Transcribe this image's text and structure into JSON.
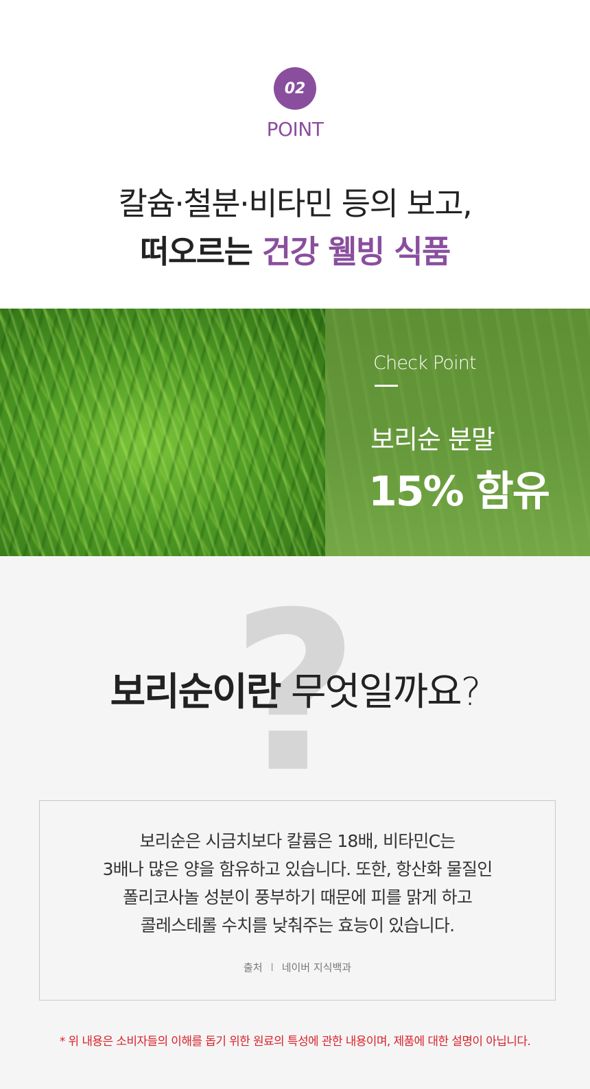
{
  "point": {
    "number": "02",
    "label": "POINT"
  },
  "headline": {
    "line1": "칼슘·철분·비타민 등의 보고,",
    "line2_plain": "떠오르는 ",
    "line2_accent": "건강 웰빙 식품"
  },
  "check_point": {
    "title": "Check Point",
    "subtitle": "보리순 분말",
    "highlight": "15% 함유"
  },
  "question": {
    "mark": "?",
    "bold": "보리순이란",
    "normal": " 무엇일까요?"
  },
  "info_box": {
    "lines": [
      "보리순은 시금치보다 칼륨은 18배, 비타민C는",
      "3배나 많은 양을 함유하고 있습니다. 또한, 항산화 물질인",
      "폴리코사놀 성분이 풍부하기 때문에 피를 맑게 하고",
      "콜레스테롤 수치를 낮춰주는 효능이 있습니다."
    ],
    "source_label": "출처",
    "source_sep": "l",
    "source_name": "네이버 지식백과"
  },
  "disclaimer": "* 위 내용은 소비자들의 이해를 돕기 위한 원료의 특성에 관한 내용이며, 제품에 대한 설명이 아닙니다.",
  "colors": {
    "accent": "#8a4e9e",
    "green_panel": "#64973a",
    "disclaimer": "#d9222a",
    "section_bg": "#f5f5f5"
  }
}
